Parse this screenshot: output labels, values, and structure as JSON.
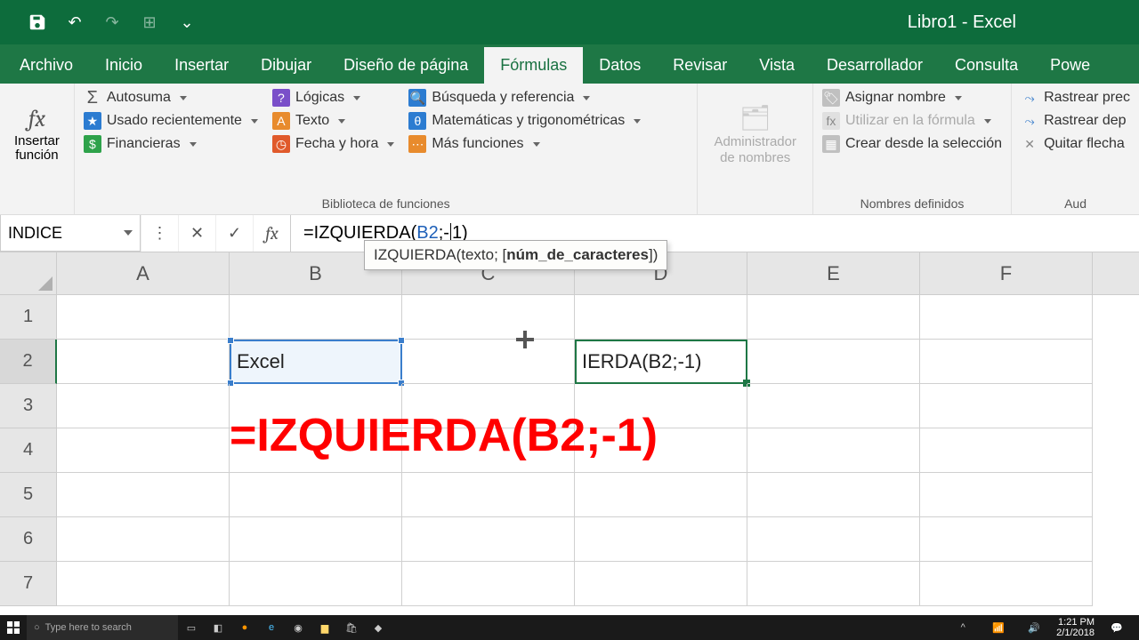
{
  "title_bar": {
    "app_title": "Libro1 - Excel"
  },
  "tabs": {
    "archivo": "Archivo",
    "inicio": "Inicio",
    "insertar": "Insertar",
    "dibujar": "Dibujar",
    "diseno": "Diseño de página",
    "formulas": "Fórmulas",
    "datos": "Datos",
    "revisar": "Revisar",
    "vista": "Vista",
    "desarrollador": "Desarrollador",
    "consulta": "Consulta",
    "power": "Powe"
  },
  "ribbon": {
    "fx_label": "Insertar\nfunción",
    "lib": {
      "autosuma": "Autosuma",
      "usado": "Usado recientemente",
      "financieras": "Financieras",
      "logicas": "Lógicas",
      "texto": "Texto",
      "fecha": "Fecha y hora",
      "busqueda": "Búsqueda y referencia",
      "matematicas": "Matemáticas y trigonométricas",
      "mas": "Más funciones",
      "group_label": "Biblioteca de funciones"
    },
    "admin": {
      "label": "Administrador\nde nombres"
    },
    "nombres": {
      "asignar": "Asignar nombre",
      "utilizar": "Utilizar en la fórmula",
      "crear": "Crear desde la selección",
      "group_label": "Nombres definidos"
    },
    "audit": {
      "rastrear_prec": "Rastrear prec",
      "rastrear_dep": "Rastrear dep",
      "quitar": "Quitar flecha",
      "group_label": "Aud"
    }
  },
  "formula_bar": {
    "name_box": "INDICE",
    "formula_prefix": "=IZQUIERDA(",
    "formula_ref": "B2",
    "formula_mid": ";-",
    "formula_suffix": "1)"
  },
  "tooltip": {
    "fn": "IZQUIERDA",
    "open": "(texto; [",
    "bold": "núm_de_caracteres",
    "close": "])"
  },
  "grid": {
    "cols": [
      "A",
      "B",
      "C",
      "D",
      "E",
      "F"
    ],
    "rows": [
      "1",
      "2",
      "3",
      "4",
      "5",
      "6",
      "7"
    ],
    "b2": "Excel",
    "d2": "IERDA(B2;-1)"
  },
  "overlay_formula": "=IZQUIERDA(B2;-1)",
  "taskbar": {
    "search_placeholder": "Type here to search",
    "time": "1:21 PM",
    "date": "2/1/2018"
  }
}
